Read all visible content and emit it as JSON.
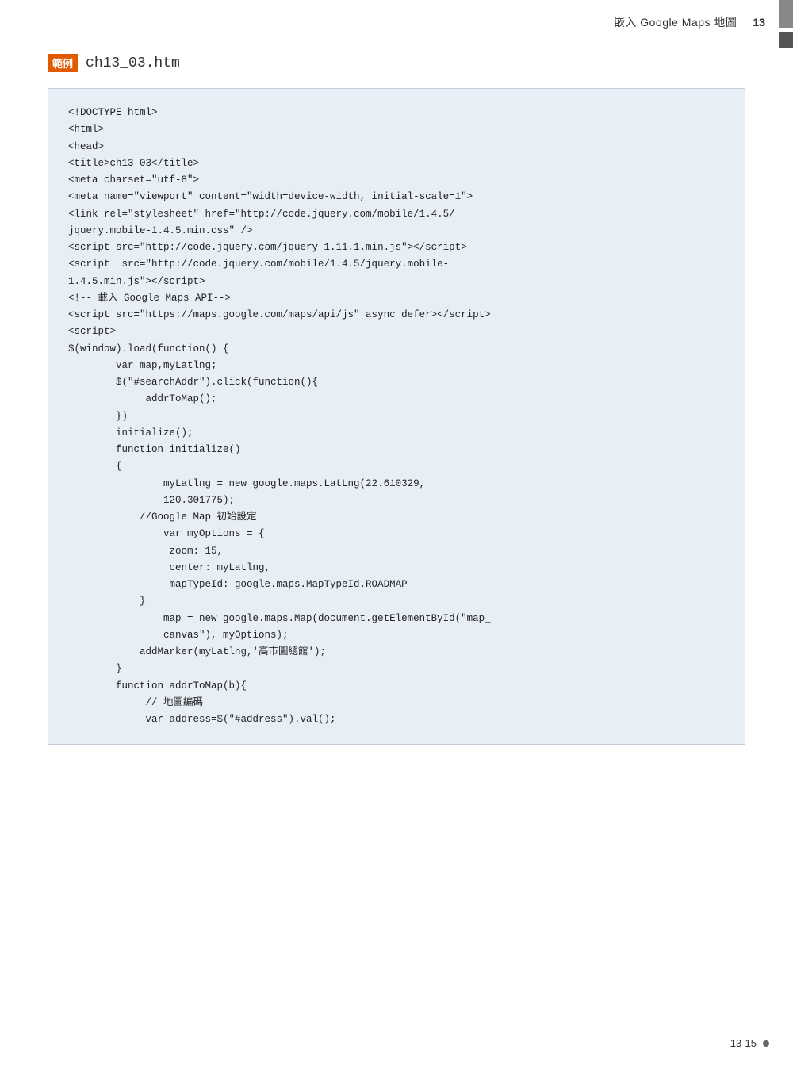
{
  "header": {
    "title": "嵌入 Google Maps 地圖",
    "page_number": "13"
  },
  "example": {
    "badge": "範例",
    "filename": "ch13_03.htm"
  },
  "page_footer": {
    "page": "13-15",
    "dot": "■"
  },
  "code": {
    "lines": [
      "<!DOCTYPE html>",
      "<html>",
      "<head>",
      "<title>ch13_03</title>",
      "<meta charset=\"utf-8\">",
      "<meta name=\"viewport\" content=\"width=device-width, initial-scale=1\">",
      "<link rel=\"stylesheet\" href=\"http://code.jquery.com/mobile/1.4.5/",
      "jquery.mobile-1.4.5.min.css\" />",
      "<script src=\"http://code.jquery.com/jquery-1.11.1.min.js\"></script>",
      "<script  src=\"http://code.jquery.com/mobile/1.4.5/jquery.mobile-",
      "1.4.5.min.js\"></script>",
      "<!-- 載入 Google Maps API-->",
      "<script src=\"https://maps.google.com/maps/api/js\" async defer></script>",
      "",
      "<script>",
      "",
      "$(window).load(function() {",
      "        var map,myLatlng;",
      "",
      "        $(\"#searchAddr\").click(function(){",
      "             addrToMap();",
      "        })",
      "",
      "        initialize();",
      "",
      "        function initialize()",
      "        {",
      "                myLatlng = new google.maps.LatLng(22.610329,",
      "                120.301775);",
      "            //Google Map 初始設定",
      "                var myOptions = {",
      "                 zoom: 15,",
      "                 center: myLatlng,",
      "                 mapTypeId: google.maps.MapTypeId.ROADMAP",
      "            }",
      "",
      "                map = new google.maps.Map(document.getElementById(\"map_",
      "                canvas\"), myOptions);",
      "            addMarker(myLatlng,'高市圖總館');",
      "",
      "        }",
      "",
      "        function addrToMap(b){",
      "             // 地圖編碼",
      "             var address=$(\"#address\").val();"
    ]
  }
}
